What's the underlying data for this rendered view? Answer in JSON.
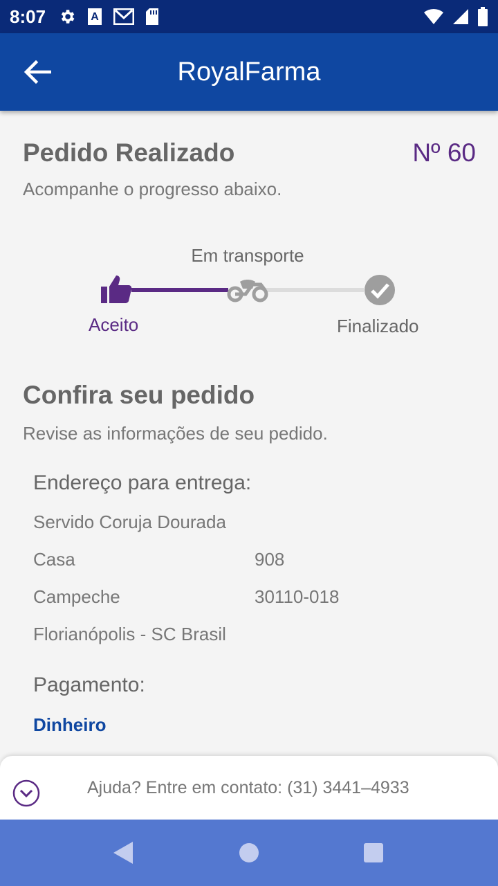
{
  "status_bar": {
    "time": "8:07"
  },
  "app_bar": {
    "title": "RoyalFarma"
  },
  "order": {
    "title": "Pedido Realizado",
    "number": "Nº  60",
    "subtitle": "Acompanhe o progresso abaixo."
  },
  "progress": {
    "step_accepted": "Aceito",
    "step_transport": "Em transporte",
    "step_finished": "Finalizado"
  },
  "review": {
    "title": "Confira seu pedido",
    "subtitle": "Revise as informações de seu pedido."
  },
  "address": {
    "heading": "Endereço para entrega:",
    "street": "Servido Coruja Dourada",
    "type": "Casa",
    "number": "908",
    "district": "Campeche",
    "zip": "30110-018",
    "city": "Florianópolis - SC  Brasil"
  },
  "payment": {
    "heading": "Pagamento:",
    "method": "Dinheiro"
  },
  "help": {
    "text": "Ajuda? Entre em contato: (31) 3441–4933"
  },
  "colors": {
    "primary": "#0f47a1",
    "status_bar": "#0a2a78",
    "accent": "#5a2a84",
    "nav_bar": "#5478d0",
    "inactive": "#9e9e9e"
  }
}
